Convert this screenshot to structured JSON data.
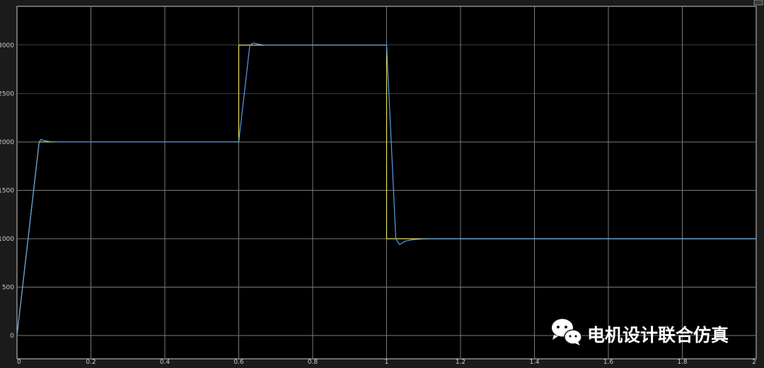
{
  "chart_data": {
    "type": "line",
    "title": "",
    "xlabel": "",
    "ylabel": "",
    "xlim": [
      0,
      2
    ],
    "ylim": [
      -240,
      3400
    ],
    "grid": true,
    "x_ticks": [
      0,
      0.2,
      0.4,
      0.6,
      0.8,
      1,
      1.2,
      1.4,
      1.6,
      1.8,
      2
    ],
    "x_tick_labels": [
      "0",
      "0.2",
      "0.4",
      "0.6",
      "0.8",
      "1",
      "1.2",
      "1.4",
      "1.6",
      "1.8",
      "2"
    ],
    "y_ticks": [
      0,
      500,
      1000,
      1500,
      2000,
      2500,
      3000
    ],
    "y_tick_labels": [
      "0",
      "500",
      "1000",
      "1500",
      "2000",
      "2500",
      "3000"
    ],
    "series": [
      {
        "color": "#e6e05a",
        "x": [
          0,
          0.06,
          0.6,
          0.6,
          1.0,
          1.0,
          2.0
        ],
        "y": [
          0,
          2000,
          2000,
          3000,
          3000,
          1000,
          1000
        ]
      },
      {
        "color": "#5a9ee6",
        "x": [
          0,
          0.06,
          0.065,
          0.075,
          0.09,
          0.11,
          0.6,
          0.63,
          0.64,
          0.655,
          0.67,
          1.0,
          1.025,
          1.035,
          1.05,
          1.07,
          1.1,
          1.13,
          2.0
        ],
        "y": [
          0,
          2000,
          2025,
          2012,
          2003,
          2000,
          2000,
          3000,
          3022,
          3008,
          3000,
          3000,
          1000,
          940,
          975,
          990,
          998,
          1000,
          1000
        ]
      }
    ]
  },
  "watermark": {
    "text": "电机设计联合仿真",
    "icon": "wechat-icon"
  }
}
